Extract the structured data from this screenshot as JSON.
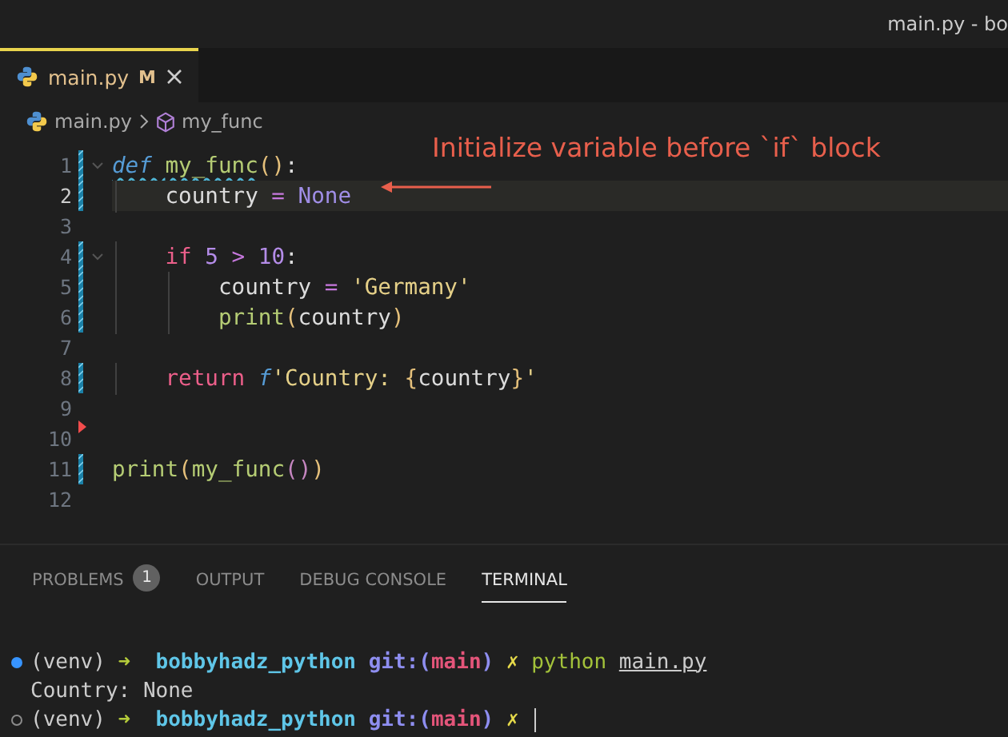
{
  "window": {
    "title": "main.py - bo"
  },
  "tabs": [
    {
      "label": "main.py",
      "badge": "M",
      "selected": true
    }
  ],
  "breadcrumb": {
    "file": "main.py",
    "symbol": "my_func"
  },
  "editor": {
    "lines": [
      {
        "number": "1",
        "kind": "modified",
        "foldable": true,
        "current": false,
        "tokens": [
          {
            "text": "def ",
            "kind": "storage",
            "squiggle": true
          },
          {
            "text": "my_func",
            "kind": "func",
            "squiggle": true
          },
          {
            "text": "()",
            "kind": "paren"
          },
          {
            "text": ":",
            "kind": "plain"
          }
        ]
      },
      {
        "number": "2",
        "kind": "modified",
        "foldable": false,
        "current": true,
        "tokens": [
          {
            "text": "    country",
            "kind": "plain"
          },
          {
            "text": " = ",
            "kind": "op"
          },
          {
            "text": "None",
            "kind": "const"
          }
        ]
      },
      {
        "number": "3",
        "kind": "unchanged",
        "foldable": false,
        "current": false
      },
      {
        "number": "4",
        "kind": "modified",
        "foldable": true,
        "current": false,
        "tokens": [
          {
            "text": "    if ",
            "kind": "keyword"
          },
          {
            "text": "5",
            "kind": "number"
          },
          {
            "text": " > ",
            "kind": "op"
          },
          {
            "text": "10",
            "kind": "number"
          },
          {
            "text": ":",
            "kind": "plain"
          }
        ]
      },
      {
        "number": "5",
        "kind": "modified",
        "foldable": false,
        "current": false,
        "tokens": [
          {
            "text": "        country",
            "kind": "plain"
          },
          {
            "text": " = ",
            "kind": "op"
          },
          {
            "text": "'Germany'",
            "kind": "string"
          }
        ]
      },
      {
        "number": "6",
        "kind": "modified",
        "foldable": false,
        "current": false,
        "tokens": [
          {
            "text": "        print",
            "kind": "func"
          },
          {
            "text": "(",
            "kind": "paren"
          },
          {
            "text": "country",
            "kind": "plain"
          },
          {
            "text": ")",
            "kind": "paren"
          }
        ]
      },
      {
        "number": "7",
        "kind": "unchanged",
        "foldable": false,
        "current": false
      },
      {
        "number": "8",
        "kind": "modified",
        "foldable": false,
        "current": false,
        "tokens": [
          {
            "text": "    return ",
            "kind": "keyword"
          },
          {
            "text": "f",
            "kind": "storage"
          },
          {
            "text": "'Country: ",
            "kind": "string"
          },
          {
            "text": "{",
            "kind": "paren"
          },
          {
            "text": "country",
            "kind": "plain"
          },
          {
            "text": "}",
            "kind": "paren"
          },
          {
            "text": "'",
            "kind": "string"
          }
        ]
      },
      {
        "number": "9",
        "kind": "unchanged",
        "foldable": false,
        "current": false
      },
      {
        "number": "10",
        "kind": "deleted",
        "foldable": false,
        "current": false
      },
      {
        "number": "11",
        "kind": "modified",
        "foldable": false,
        "current": false,
        "tokens": [
          {
            "text": "print",
            "kind": "func"
          },
          {
            "text": "(",
            "kind": "paren"
          },
          {
            "text": "my_func",
            "kind": "func"
          },
          {
            "text": "()",
            "kind": "paren2"
          },
          {
            "text": ")",
            "kind": "paren"
          }
        ]
      },
      {
        "number": "12",
        "kind": "unchanged",
        "foldable": false,
        "current": false
      }
    ]
  },
  "annotation": {
    "text": "Initialize variable before `if` block"
  },
  "panel": {
    "tabs": [
      {
        "label": "PROBLEMS",
        "count": "1",
        "selected": false
      },
      {
        "label": "OUTPUT",
        "selected": false
      },
      {
        "label": "DEBUG CONSOLE",
        "selected": false
      },
      {
        "label": "TERMINAL",
        "selected": true
      }
    ]
  },
  "terminal": {
    "lines": [
      {
        "kind": "done",
        "cursor": false,
        "segments": [
          {
            "text": "(venv) ",
            "kind": "plain"
          },
          {
            "text": "➜ ",
            "kind": "arrow"
          },
          {
            "text": " bobbyhadz_python ",
            "kind": "dir"
          },
          {
            "text": "git:(",
            "kind": "git"
          },
          {
            "text": "main",
            "kind": "branch"
          },
          {
            "text": ") ",
            "kind": "git"
          },
          {
            "text": "✗ ",
            "kind": "dirty"
          },
          {
            "text": "python ",
            "kind": "command"
          },
          {
            "text": "main.py",
            "kind": "path"
          }
        ]
      },
      {
        "kind": "output",
        "cursor": false,
        "segments": [
          {
            "text": "Country: None",
            "kind": "plain"
          }
        ]
      },
      {
        "kind": "idle",
        "cursor": true,
        "segments": [
          {
            "text": "(venv) ",
            "kind": "plain"
          },
          {
            "text": "➜ ",
            "kind": "arrow"
          },
          {
            "text": " bobbyhadz_python ",
            "kind": "dir"
          },
          {
            "text": "git:(",
            "kind": "git"
          },
          {
            "text": "main",
            "kind": "branch"
          },
          {
            "text": ") ",
            "kind": "git"
          },
          {
            "text": "✗ ",
            "kind": "dirty"
          }
        ]
      }
    ]
  }
}
